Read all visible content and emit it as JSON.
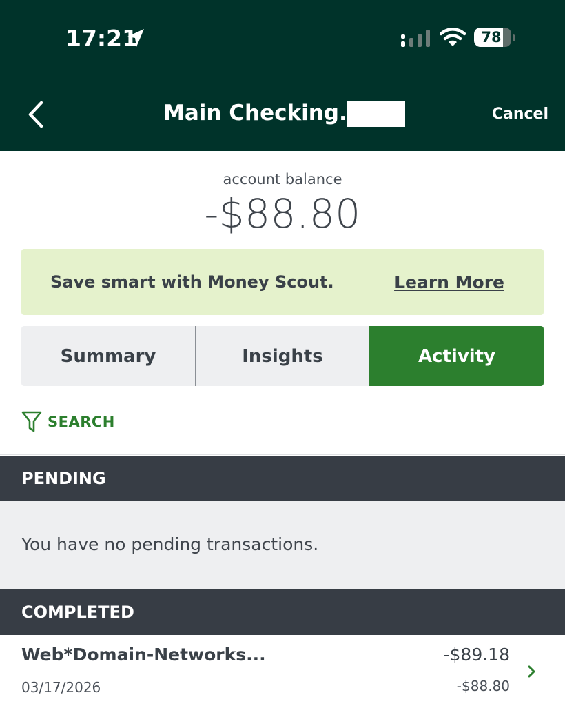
{
  "status_bar": {
    "time": "17:21",
    "battery_level": "78",
    "battery_fraction": 0.78,
    "icons": [
      "location-arrow-icon",
      "cellular-signal-icon",
      "wifi-icon",
      "battery-icon"
    ]
  },
  "nav": {
    "title": "Main Checking...",
    "back_icon": "chevron-left-icon",
    "cancel_label": "Cancel"
  },
  "balance": {
    "label": "account balance",
    "value": "-$88.80"
  },
  "promo": {
    "text": "Save smart with Money Scout.",
    "link_label": "Learn More"
  },
  "tabs": [
    {
      "label": "Summary",
      "active": false
    },
    {
      "label": "Insights",
      "active": false
    },
    {
      "label": "Activity",
      "active": true
    }
  ],
  "search": {
    "icon": "filter-icon",
    "label": "SEARCH"
  },
  "pending": {
    "header": "PENDING",
    "empty_message": "You have no pending transactions."
  },
  "completed": {
    "header": "COMPLETED",
    "transactions": [
      {
        "name": "Web*Domain-Networks...",
        "date": "03/17/2026",
        "amount": "-$89.18",
        "running_balance": "-$88.80"
      }
    ]
  },
  "colors": {
    "header_bg": "#00332a",
    "accent_green": "#2c7f2e",
    "promo_bg": "#e5f2cc",
    "section_header_bg": "#373d45",
    "pending_bg": "#eeeff1"
  }
}
